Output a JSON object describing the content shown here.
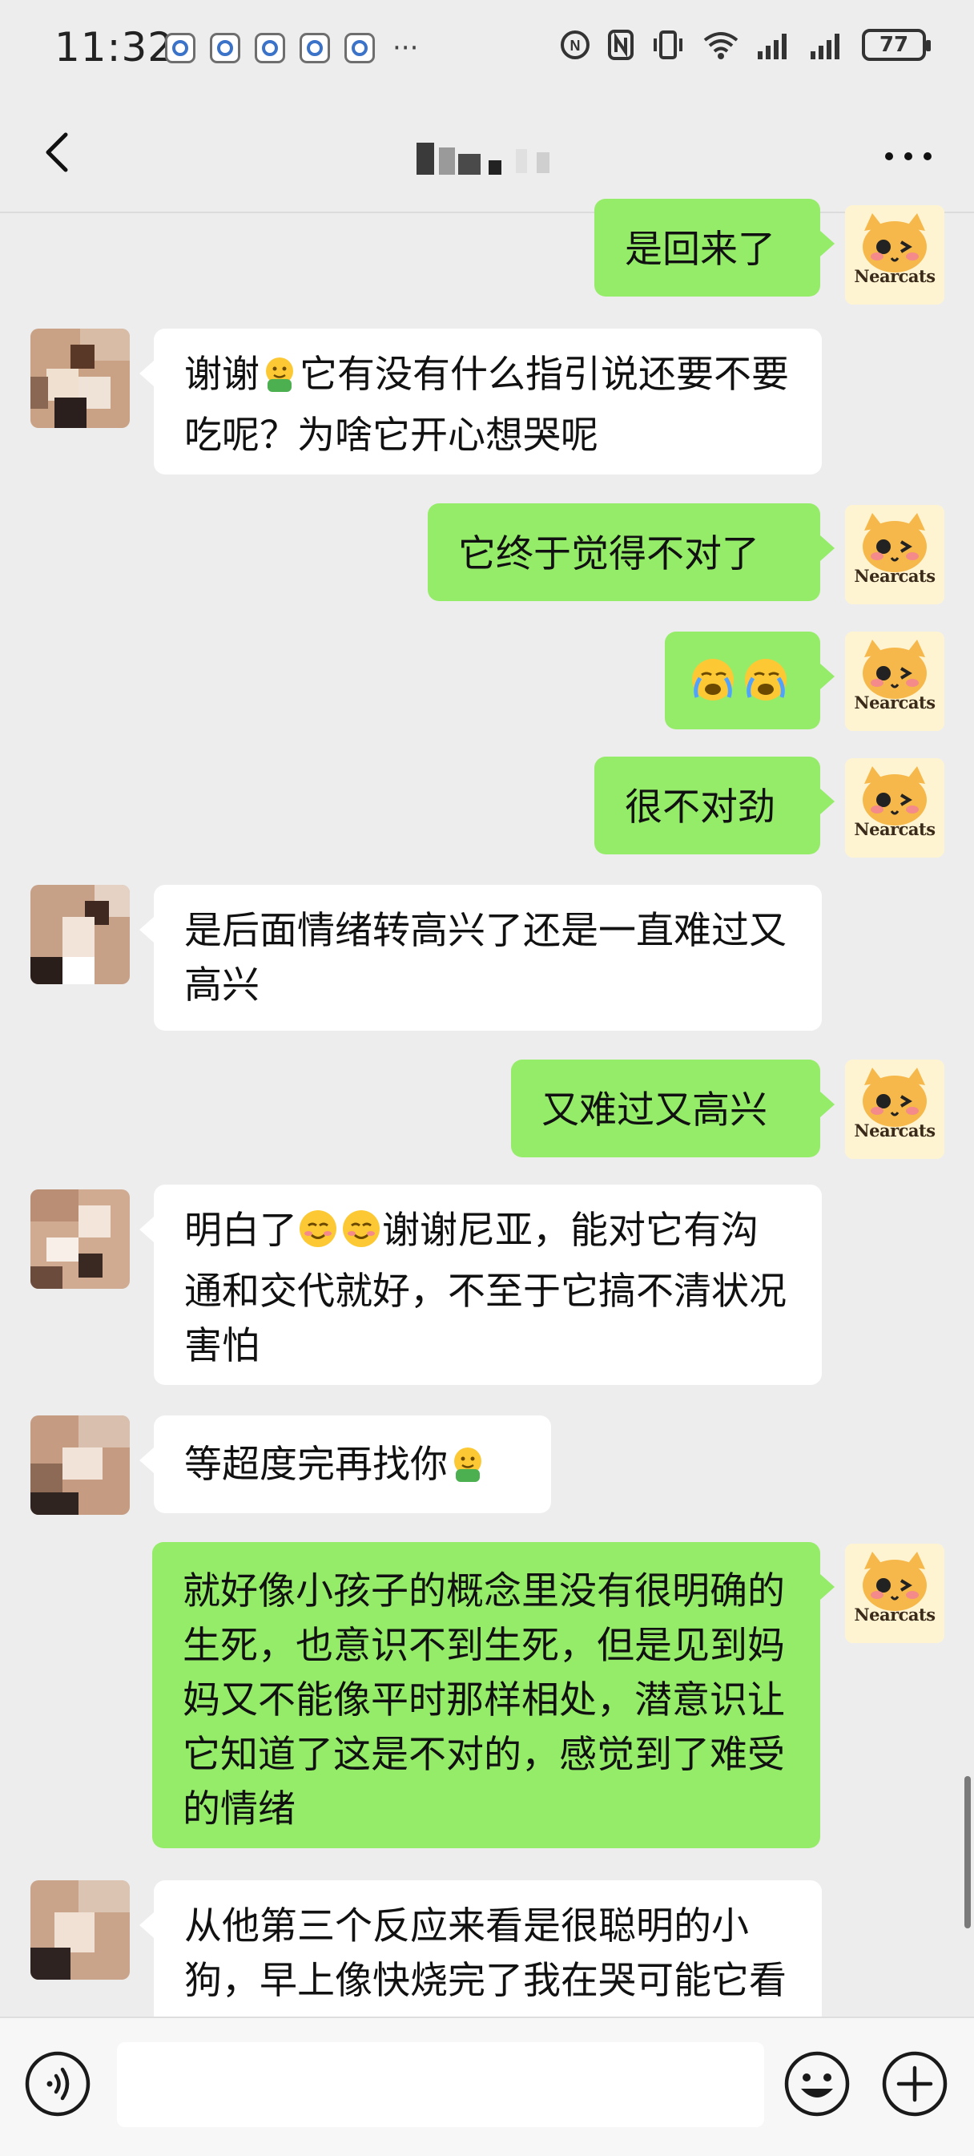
{
  "status_bar": {
    "time": "11:32",
    "more_indicator": "···",
    "battery": "77",
    "notification_icons": [
      "app-notification-icon",
      "app-notification-icon",
      "app-notification-icon",
      "app-notification-icon",
      "app-notification-icon"
    ],
    "right_icons": [
      "nfc-icon",
      "n-mode-icon",
      "vibrate-icon",
      "wifi-icon",
      "signal-icon",
      "signal-icon",
      "battery-icon"
    ]
  },
  "header": {
    "back_icon": "chevron-left-icon",
    "title_obscured": true,
    "more_icon": "more-dots-icon"
  },
  "messages": [
    {
      "side": "out",
      "text": "是回来了",
      "avatar": "Nearcats"
    },
    {
      "side": "in",
      "text_parts": [
        "谢谢",
        "🤗",
        "它有没有什么指引说还要不要吃呢？为啥它开心想哭呢"
      ]
    },
    {
      "side": "out",
      "text": "它终于觉得不对了",
      "avatar": "Nearcats"
    },
    {
      "side": "out",
      "text": "😭😭",
      "avatar": "Nearcats"
    },
    {
      "side": "out",
      "text": "很不对劲",
      "avatar": "Nearcats"
    },
    {
      "side": "in",
      "text": "是后面情绪转高兴了还是一直难过又高兴"
    },
    {
      "side": "out",
      "text": "又难过又高兴",
      "avatar": "Nearcats"
    },
    {
      "side": "in",
      "text_parts": [
        "明白了",
        "☺️☺️",
        "谢谢尼亚，能对它有沟通和交代就好，不至于它搞不清状况害怕"
      ]
    },
    {
      "side": "in",
      "text_parts": [
        "等超度完再找你",
        "🤗"
      ]
    },
    {
      "side": "out",
      "text": "就好像小孩子的概念里没有很明确的生死，也意识不到生死，但是见到妈妈又不能像平时那样相处，潜意识让它知道了这是不对的，感觉到了难受的情绪",
      "avatar": "Nearcats"
    },
    {
      "side": "in",
      "text": "从他第三个反应来看是很聪明的小狗，早上像快烧完了我在哭可能它看到了"
    }
  ],
  "input_bar": {
    "voice_icon": "voice-icon",
    "input_value": "",
    "emoji_icon": "emoji-icon",
    "plus_icon": "plus-icon"
  },
  "colors": {
    "background": "#ededed",
    "outgoing_bubble": "#95ec69",
    "incoming_bubble": "#ffffff"
  }
}
